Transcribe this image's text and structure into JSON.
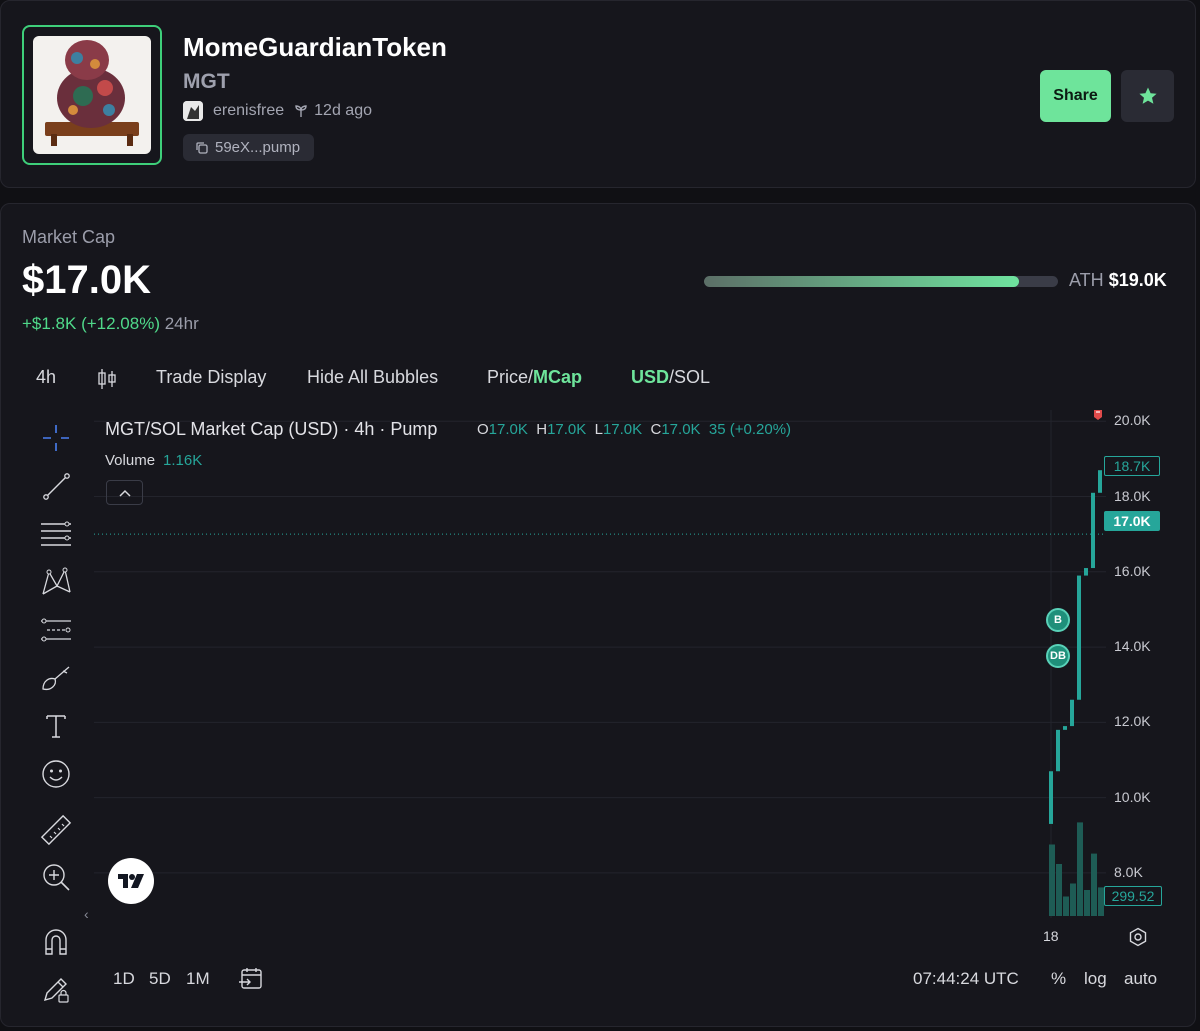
{
  "token": {
    "name": "MomeGuardianToken",
    "symbol": "MGT",
    "creator": "erenisfree",
    "age": "12d ago",
    "address": "59eX...pump"
  },
  "actions": {
    "share_label": "Share",
    "favorite_icon": "star-icon"
  },
  "market": {
    "label": "Market Cap",
    "value": "$17.0K",
    "change": "+$1.8K (+12.08%)",
    "change_period": "24hr",
    "ath_label": "ATH",
    "ath_value": "$19.0K",
    "ath_progress_percent": 89
  },
  "toolbar": {
    "interval": "4h",
    "trade_display": "Trade Display",
    "hide_bubbles": "Hide All Bubbles",
    "price_label": "Price",
    "mcap_label": "MCap",
    "separator": "/",
    "usd_label": "USD",
    "sol_label": "SOL"
  },
  "chart_header": {
    "title": "MGT/SOL Market Cap (USD) · 4h · Pump",
    "open_label": "O",
    "open": "17.0K",
    "high_label": "H",
    "high": "17.0K",
    "low_label": "L",
    "low": "17.0K",
    "close_label": "C",
    "close": "17.0K",
    "change": "35 (+0.20%)",
    "volume_label": "Volume",
    "volume": "1.16K"
  },
  "bottom_bar": {
    "ranges": [
      "1D",
      "5D",
      "1M"
    ],
    "time": "07:44:24 UTC",
    "percent": "%",
    "log": "log",
    "auto": "auto"
  },
  "colors": {
    "accent": "#6ee49b",
    "up": "#26a69a",
    "background": "#16161c"
  },
  "chart_data": {
    "type": "line",
    "title": "MGT/SOL Market Cap (USD) · 4h · Pump",
    "y_tick_labels": [
      "20.0K",
      "18.0K",
      "16.0K",
      "14.0K",
      "12.0K",
      "10.0K",
      "8.0K"
    ],
    "ylim": [
      6800,
      20300
    ],
    "x_tick_label": "18",
    "price_tags": {
      "high": "18.7K",
      "last": "17.0K",
      "volume": "299.52"
    },
    "steps": [
      {
        "open": 9300,
        "close": 10700
      },
      {
        "open": 10700,
        "close": 11800
      },
      {
        "open": 11800,
        "close": 11900
      },
      {
        "open": 11900,
        "close": 12600
      },
      {
        "open": 12600,
        "close": 15900
      },
      {
        "open": 15900,
        "close": 16100
      },
      {
        "open": 16100,
        "close": 18100
      },
      {
        "open": 18100,
        "close": 18700
      }
    ],
    "volume_bars": [
      0.55,
      0.4,
      0.15,
      0.25,
      0.72,
      0.2,
      0.48,
      0.22
    ],
    "markers": [
      "B",
      "DB"
    ]
  }
}
